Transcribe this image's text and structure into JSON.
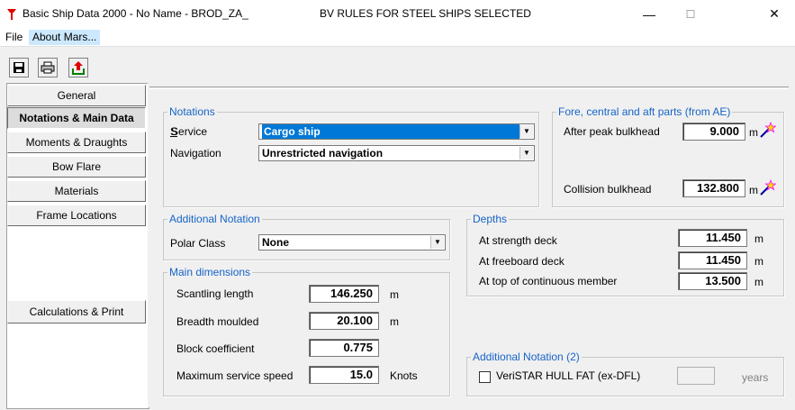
{
  "window": {
    "title": "Basic Ship Data 2000 - No Name - BROD_ZA_",
    "rules_label": "BV RULES FOR STEEL SHIPS SELECTED",
    "minimize": "—",
    "maximize": "☐",
    "close": "✕"
  },
  "menu": {
    "file": "File",
    "about": "About Mars..."
  },
  "toolbar": {
    "save_icon": "save-icon",
    "print_icon": "print-icon",
    "export_icon": "export-icon"
  },
  "nav": {
    "items": [
      {
        "label": "General"
      },
      {
        "label": "Notations & Main Data"
      },
      {
        "label": "Moments & Draughts"
      },
      {
        "label": "Bow Flare"
      },
      {
        "label": "Materials"
      },
      {
        "label": "Frame Locations"
      }
    ],
    "calc": "Calculations & Print"
  },
  "notations": {
    "title": "Notations",
    "service_label": "Service",
    "service_value": "Cargo ship",
    "navigation_label": "Navigation",
    "navigation_value": "Unrestricted navigation"
  },
  "fore": {
    "title": "Fore, central and aft parts (from AE)",
    "after_peak_label": "After peak bulkhead",
    "after_peak_value": "9.000",
    "collision_label": "Collision bulkhead",
    "collision_value": "132.800",
    "unit": "m"
  },
  "additional": {
    "title": "Additional Notation",
    "polar_label": "Polar Class",
    "polar_value": "None"
  },
  "depths": {
    "title": "Depths",
    "strength_label": "At strength deck",
    "strength_value": "11.450",
    "freeboard_label": "At freeboard deck",
    "freeboard_value": "11.450",
    "top_label": "At top of continuous member",
    "top_value": "13.500",
    "unit": "m"
  },
  "main": {
    "title": "Main dimensions",
    "scantling_label": "Scantling length",
    "scantling_value": "146.250",
    "scantling_unit": "m",
    "breadth_label": "Breadth moulded",
    "breadth_value": "20.100",
    "breadth_unit": "m",
    "block_label": "Block coefficient",
    "block_value": "0.775",
    "speed_label": "Maximum service speed",
    "speed_value": "15.0",
    "speed_unit": "Knots"
  },
  "additional2": {
    "title": "Additional Notation (2)",
    "veristar_label": "VeriSTAR HULL FAT (ex-DFL)",
    "veristar_checked": false,
    "years_value": "",
    "years_unit": "years"
  },
  "colors": {
    "accent": "#0078d7",
    "group_label": "#1764c8"
  }
}
